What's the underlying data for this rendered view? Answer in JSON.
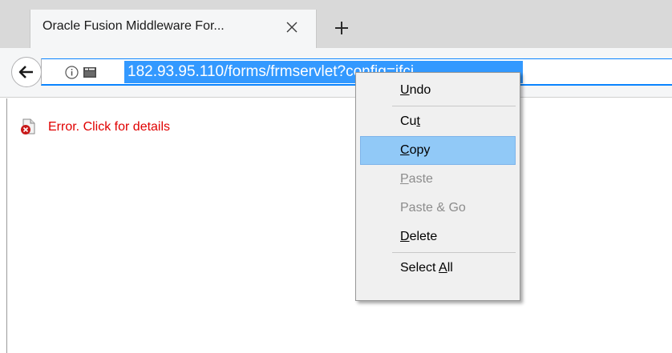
{
  "tab": {
    "title": "Oracle Fusion Middleware For...",
    "close_icon": "close-icon",
    "new_tab_icon": "plus-icon"
  },
  "navbar": {
    "back_icon": "back-arrow-icon",
    "info_icon": "info-icon",
    "page_icon": "page-icon",
    "url": "182.93.95.110/forms/frmservlet?config=jfci"
  },
  "content": {
    "error_icon": "error-document-icon",
    "error_text": "Error. Click for details"
  },
  "context_menu": {
    "items": [
      {
        "label": "Undo",
        "before": "",
        "accel": "U",
        "after": "ndo",
        "state": "enabled"
      },
      {
        "label": "Cut",
        "before": "Cu",
        "accel": "t",
        "after": "",
        "state": "enabled"
      },
      {
        "label": "Copy",
        "before": "",
        "accel": "C",
        "after": "opy",
        "state": "highlighted"
      },
      {
        "label": "Paste",
        "before": "",
        "accel": "P",
        "after": "aste",
        "state": "disabled"
      },
      {
        "label": "Paste & Go",
        "before": "Paste & Go",
        "accel": "",
        "after": "",
        "state": "disabled"
      },
      {
        "label": "Delete",
        "before": "",
        "accel": "D",
        "after": "elete",
        "state": "enabled"
      },
      {
        "label": "Select All",
        "before": "Select ",
        "accel": "A",
        "after": "ll",
        "state": "enabled"
      }
    ]
  },
  "colors": {
    "selection": "#3399ff",
    "error": "#e00000",
    "menu_highlight": "#91c9f7",
    "focus_ring": "#0a84ff"
  }
}
